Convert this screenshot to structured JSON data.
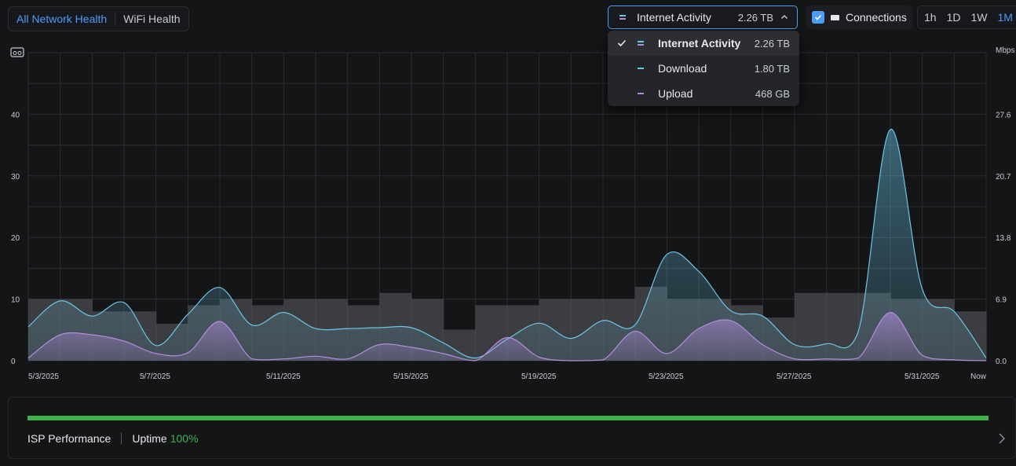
{
  "tabs": {
    "network_health": "All Network Health",
    "wifi_health": "WiFi Health"
  },
  "activity_select": {
    "label": "Internet Activity",
    "total": "2.26 TB"
  },
  "dropdown": {
    "items": [
      {
        "label": "Internet Activity",
        "value": "2.26 TB",
        "selected": true
      },
      {
        "label": "Download",
        "value": "1.80 TB",
        "selected": false
      },
      {
        "label": "Upload",
        "value": "468 GB",
        "selected": false
      }
    ]
  },
  "connections": {
    "label": "Connections",
    "checked": true
  },
  "ranges": [
    "1h",
    "1D",
    "1W",
    "1M"
  ],
  "ranges_active": "1M",
  "colors": {
    "accent": "#4c9df8",
    "download": "#6bc6e8",
    "upload": "#b58ce0",
    "connections": "#4a4b4f",
    "uptime": "#3eb24a"
  },
  "chart_data": {
    "type": "area",
    "left_axis": {
      "ticks": [
        "0",
        "10",
        "20",
        "30",
        "40"
      ],
      "range": [
        0,
        50
      ]
    },
    "right_axis": {
      "unit": "Mbps",
      "ticks": [
        "0.0",
        "6.9",
        "13.8",
        "20.7",
        "27.6"
      ],
      "range": [
        0,
        34.5
      ]
    },
    "x_labels": [
      "5/3/2025",
      "5/7/2025",
      "5/11/2025",
      "5/15/2025",
      "5/19/2025",
      "5/23/2025",
      "5/27/2025",
      "5/31/2025",
      "Now"
    ],
    "connections": [
      10,
      10,
      8,
      8,
      6,
      9,
      10,
      9,
      10,
      10,
      9,
      11,
      10,
      5,
      9,
      9,
      10,
      10,
      10,
      12,
      10,
      10,
      9,
      7,
      11,
      11,
      11,
      10,
      10,
      8
    ],
    "download_mbps": [
      3.8,
      6.7,
      5.0,
      6.5,
      1.7,
      5.2,
      8.2,
      4.0,
      5.4,
      3.6,
      3.6,
      3.7,
      3.7,
      2.0,
      0.3,
      2.4,
      4.2,
      2.5,
      4.5,
      4.0,
      11.9,
      10.0,
      5.6,
      5.0,
      1.8,
      1.9,
      3.3,
      25.9,
      8.0,
      5.5,
      0.3
    ],
    "upload_mbps": [
      0.3,
      2.9,
      2.9,
      2.2,
      0.8,
      0.9,
      4.4,
      0.2,
      0.2,
      0.5,
      0.2,
      1.8,
      1.5,
      0.8,
      0.0,
      2.6,
      0.4,
      0.0,
      0.1,
      3.3,
      0.8,
      3.6,
      4.5,
      1.8,
      0.2,
      0.2,
      0.3,
      5.4,
      0.6,
      0.1,
      0.0
    ]
  },
  "isp": {
    "label": "ISP Performance",
    "uptime_label": "Uptime",
    "uptime_value": "100%",
    "uptime_fraction": 1.0
  }
}
